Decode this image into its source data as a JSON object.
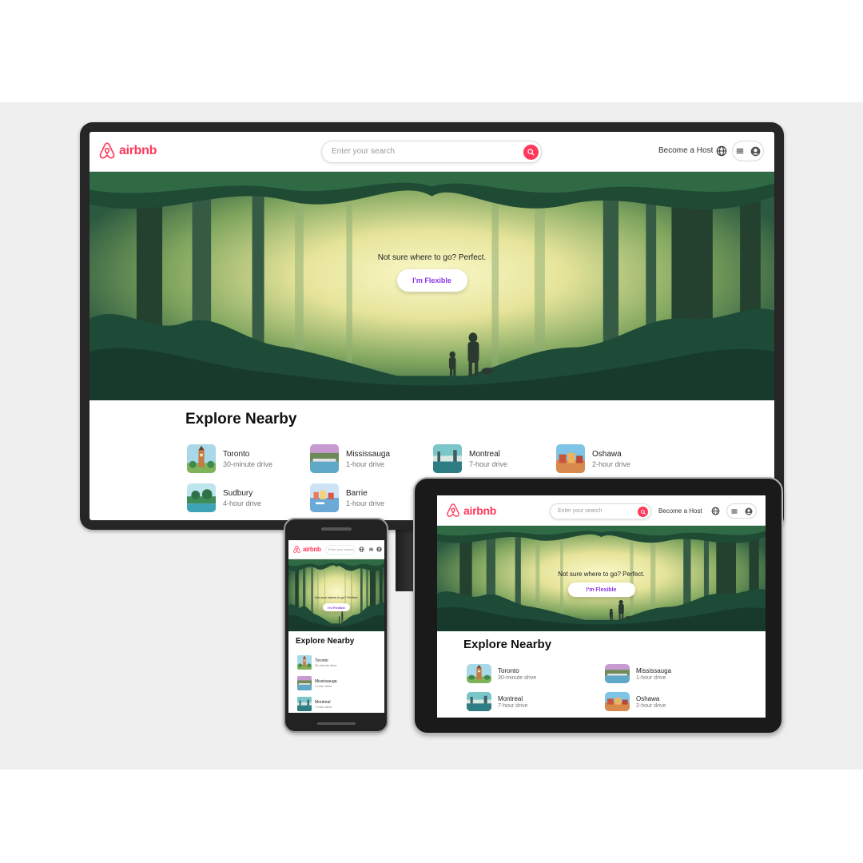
{
  "brand": {
    "name": "airbnb",
    "color": "#FF385C"
  },
  "colors": {
    "accent_purple": "#8B33E8",
    "forest_dark": "#1E4A38",
    "sunlight": "#F4F1B0"
  },
  "desktop": {
    "search_placeholder": "Enter your search",
    "become_host": "Become a Host",
    "hero_tagline": "Not sure where to go? Perfect.",
    "flexible_button": "I'm Flexible",
    "section_title": "Explore Nearby",
    "nearby": [
      {
        "name": "Toronto",
        "sub": "30-minute drive",
        "icon": "toronto-thumb"
      },
      {
        "name": "Mississauga",
        "sub": "1-hour drive",
        "icon": "mississauga-thumb"
      },
      {
        "name": "Montreal",
        "sub": "7-hour drive",
        "icon": "montreal-thumb"
      },
      {
        "name": "Oshawa",
        "sub": "2-hour drive",
        "icon": "oshawa-thumb"
      },
      {
        "name": "Sudbury",
        "sub": "4-hour drive",
        "icon": "sudbury-thumb"
      },
      {
        "name": "Barrie",
        "sub": "1-hour drive",
        "icon": "barrie-thumb"
      }
    ]
  },
  "tablet": {
    "search_placeholder": "Enter your search",
    "become_host": "Become a Host",
    "hero_tagline": "Not sure where to go? Perfect.",
    "flexible_button": "I'm Flexible",
    "section_title": "Explore Nearby",
    "nearby": [
      {
        "name": "Toronto",
        "sub": "30-minute drive",
        "icon": "toronto-thumb"
      },
      {
        "name": "Mississauga",
        "sub": "1-hour drive",
        "icon": "mississauga-thumb"
      },
      {
        "name": "Montreal",
        "sub": "7-hour drive",
        "icon": "montreal-thumb"
      },
      {
        "name": "Oshawa",
        "sub": "2-hour drive",
        "icon": "oshawa-thumb"
      }
    ]
  },
  "phone": {
    "search_placeholder": "Enter your search",
    "hero_tagline": "Not sure where to go? Perfect.",
    "flexible_button": "I'm Flexible",
    "section_title": "Explore Nearby",
    "nearby": [
      {
        "name": "Toronto",
        "sub": "30-minute drive",
        "icon": "toronto-thumb"
      },
      {
        "name": "Mississauga",
        "sub": "1-hour drive",
        "icon": "mississauga-thumb"
      },
      {
        "name": "Montreal",
        "sub": "7-hour drive",
        "icon": "montreal-thumb"
      }
    ]
  }
}
